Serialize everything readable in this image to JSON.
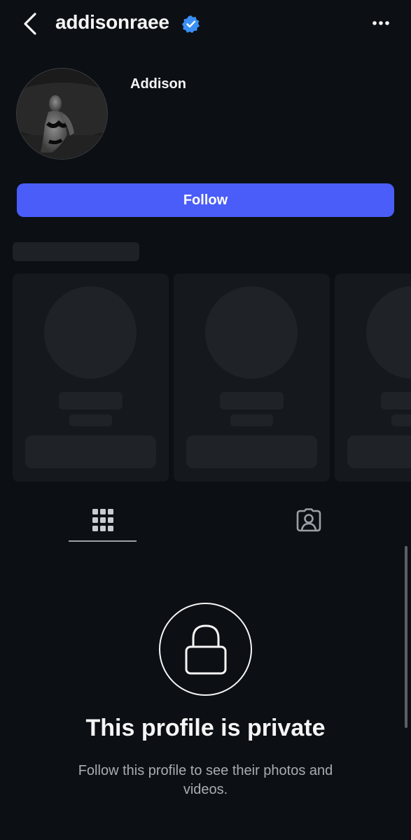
{
  "header": {
    "username": "addisonraee",
    "verified": true,
    "icons": {
      "back": "chevron-left-icon",
      "verified": "verified-badge-icon",
      "more": "more-horizontal-icon"
    }
  },
  "profile": {
    "display_name": "Addison",
    "follow_label": "Follow"
  },
  "tabs": [
    {
      "name": "posts-grid",
      "icon": "grid-icon",
      "active": true
    },
    {
      "name": "tagged",
      "icon": "tagged-person-icon",
      "active": false
    }
  ],
  "private_notice": {
    "icon": "lock-icon",
    "title": "This profile is private",
    "subtitle": "Follow this profile to see their photos and videos."
  },
  "colors": {
    "background": "#0c1014",
    "accent": "#4a5df9",
    "verified": "#3a8ff5",
    "text": "#f5f5f5",
    "muted_text": "#a8adb3"
  }
}
